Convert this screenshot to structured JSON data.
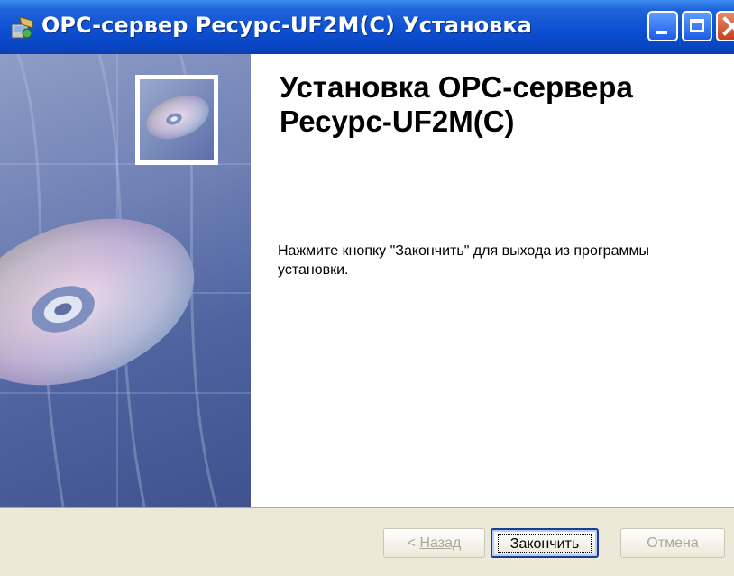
{
  "window": {
    "title": "OPC-сервер Ресурс-UF2M(C) Установка"
  },
  "titlebar_buttons": {
    "minimize": "minimize-icon",
    "maximize": "maximize-icon",
    "close": "close-icon"
  },
  "banner": {
    "image": "cd-disc-illustration"
  },
  "content": {
    "heading": "Установка OPC-сервера Ресурс-UF2M(C)",
    "message": "Нажмите кнопку \"Закончить\" для выхода из программы установки."
  },
  "buttons": {
    "back": {
      "prefix": "< ",
      "label": "Назад",
      "enabled": false
    },
    "finish": {
      "label": "Закончить",
      "enabled": true,
      "default": true
    },
    "cancel": {
      "label": "Отмена",
      "enabled": false
    }
  },
  "colors": {
    "titlebar": "#0a46c4",
    "dialog_bg": "#ece9d8",
    "banner": "#5a6ca6",
    "disabled_text": "#aca899"
  }
}
